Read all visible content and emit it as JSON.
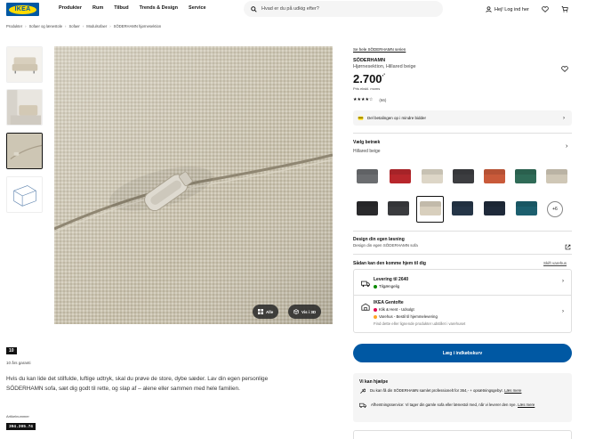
{
  "header": {
    "logo_text": "IKEA",
    "nav": [
      "Produkter",
      "Rum",
      "Tilbud",
      "Trends & Design",
      "Service"
    ],
    "search_placeholder": "Hvad er du på udkig efter?",
    "login_label": "Hej! Log ind her"
  },
  "breadcrumb": [
    "Produkter",
    "Sofaer og lænestole",
    "Sofaer",
    "Modulsofaer",
    "SÖDERHAMN hjørnesektion"
  ],
  "gallery": {
    "buttons": [
      {
        "label": "Alle",
        "icon": "grid-icon"
      },
      {
        "label": "Vis i 3D",
        "icon": "cube-icon"
      }
    ]
  },
  "below_image": {
    "badge": "10",
    "warranty": "10 års garanti",
    "description": "Hvis du kan lide det stilfulde, luftige udtryk, skal du prøve de store, dybe sæder. Lav din egen personlige SÖDERHAMN sofa, sæt dig godt til rette, og slap af – alene eller sammen med hele familien.",
    "article_label": "Artikelnummer",
    "article_number": "394.205.74"
  },
  "product": {
    "series_link": "Se hele SÖDERHAMN serien",
    "name": "SÖDERHAMN",
    "description": "Hjørnesektion, Hillared beige",
    "price": "2.700",
    "price_suffix": ",-",
    "price_sub": "Pris ekskl. moms",
    "stars": "★★★★☆",
    "review_count": "(66)",
    "payment_text": "Del betalingen op i mindre bidder"
  },
  "color": {
    "title": "Vælg betræk",
    "value": "Hillared beige",
    "swatches": [
      {
        "name": "grey",
        "color": "#6b6d70"
      },
      {
        "name": "red",
        "color": "#b8272c"
      },
      {
        "name": "beige",
        "color": "#ddd6c7"
      },
      {
        "name": "dark-grey",
        "color": "#3c3d40"
      },
      {
        "name": "orange",
        "color": "#c95a3a"
      },
      {
        "name": "green",
        "color": "#2f6b57"
      },
      {
        "name": "light-beige",
        "color": "#cfc7b6"
      },
      {
        "name": "black",
        "color": "#2a2a2c"
      },
      {
        "name": "anthracite",
        "color": "#3a3b3e"
      },
      {
        "name": "selected-beige",
        "color": "#d8cfbd"
      },
      {
        "name": "dark-blue",
        "color": "#253547"
      },
      {
        "name": "navy",
        "color": "#1f2a3a"
      },
      {
        "name": "teal",
        "color": "#1c5f6e"
      }
    ],
    "more_label": "+6"
  },
  "design": {
    "title": "Design din egen løsning",
    "sub": "Design din egen SÖDERHAMN sofa"
  },
  "delivery": {
    "title": "Sådan kan den komme hjem til dig",
    "change_store": "Skift varehus",
    "home_title": "Levering til 2640",
    "home_status": "Tilgængelig",
    "store_title": "IKEA Gentofte",
    "store_line1": "Klik & Hent - Udsolgt",
    "store_line2": "Varehus - Bestil til hjemmelevering",
    "store_line3": "Find dette eller lignende produkter udstillet i varehuset"
  },
  "cart_button": "Læg i indkøbskurv",
  "help": {
    "title": "Vi kan hjælpe",
    "row1_text": "Du kan få din SÖDERHAMN samlet professionelt for 364,- + opsætningsgebyr.",
    "row1_link": "Læs mere",
    "row2_text": "Afhentningsservice: Vi tager din gamle sofa eller lænestol med, når vi leverer den nye.",
    "row2_link": "Læs mere"
  },
  "colors": {
    "brand_blue": "#0058a3",
    "brand_yellow": "#ffdb00",
    "available_green": "#0a8a00",
    "unavailable_red": "#e00751",
    "warning_orange": "#ffa524"
  }
}
